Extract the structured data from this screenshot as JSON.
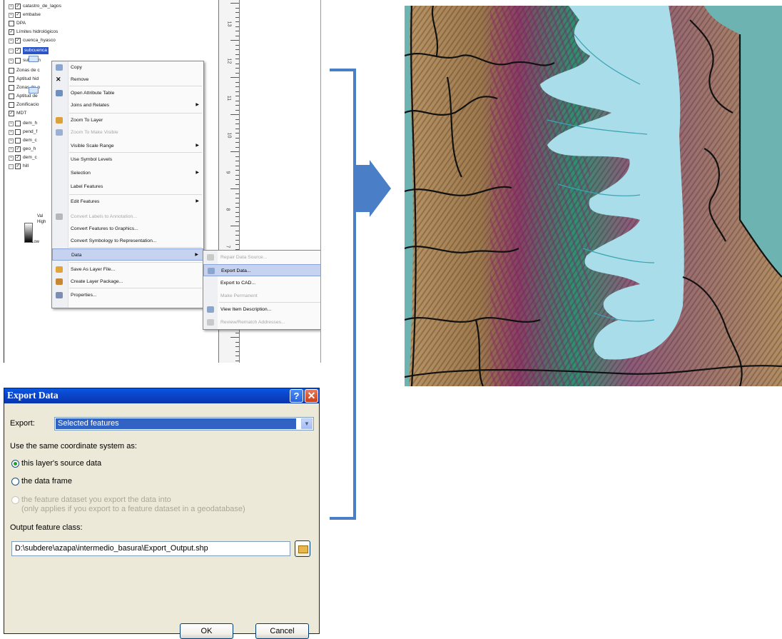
{
  "toc": {
    "items": [
      {
        "label": "catastro_de_lagos",
        "checked": true,
        "expand": "+"
      },
      {
        "label": "embalse",
        "checked": true,
        "expand": "+"
      },
      {
        "label": "DPA",
        "checked": false,
        "expand": ""
      },
      {
        "label": "Límites hidrológicos",
        "checked": true,
        "expand": ""
      },
      {
        "label": "cuenca_hyasco",
        "checked": true,
        "expand": "+"
      },
      {
        "label": "subcuenca",
        "checked": true,
        "expand": "-",
        "selected": true
      },
      {
        "label": "subcuen",
        "checked": false,
        "expand": "+"
      },
      {
        "label": "Zonas de c",
        "checked": false,
        "expand": ""
      },
      {
        "label": "Aptitud hid",
        "checked": false,
        "expand": ""
      },
      {
        "label": "Zonas de p",
        "checked": false,
        "expand": ""
      },
      {
        "label": "Aptitud de",
        "checked": false,
        "expand": ""
      },
      {
        "label": "Zonificacio",
        "checked": false,
        "expand": ""
      },
      {
        "label": "MDT",
        "checked": true,
        "expand": ""
      },
      {
        "label": "dem_h",
        "checked": false,
        "expand": "+"
      },
      {
        "label": "pend_f",
        "checked": false,
        "expand": "+"
      },
      {
        "label": "dem_c",
        "checked": false,
        "expand": "+"
      },
      {
        "label": "geo_h",
        "checked": true,
        "expand": "+"
      },
      {
        "label": "dem_c",
        "checked": true,
        "expand": "+"
      },
      {
        "label": "hill",
        "checked": true,
        "expand": "-"
      }
    ],
    "ramp_high": "High",
    "ramp_low": "Low",
    "ramp_value": "Val"
  },
  "ruler": {
    "numbers": [
      "13",
      "12",
      "11",
      "10",
      "9",
      "8",
      "7",
      "6",
      "5"
    ]
  },
  "context_menu": {
    "items": [
      {
        "label": "Copy",
        "icon": "copy-icon",
        "disabled": false,
        "submenu": false
      },
      {
        "label": "Remove",
        "icon": "remove-icon",
        "disabled": false,
        "submenu": false
      },
      {
        "label": "Open Attribute Table",
        "icon": "table-icon",
        "disabled": false,
        "submenu": false
      },
      {
        "label": "Joins and Relates",
        "icon": "",
        "disabled": false,
        "submenu": true
      },
      {
        "label": "Zoom To Layer",
        "icon": "zoom-layer-icon",
        "disabled": false,
        "submenu": false
      },
      {
        "label": "Zoom To Make Visible",
        "icon": "zoom-visible-icon",
        "disabled": true,
        "submenu": false
      },
      {
        "label": "Visible Scale Range",
        "icon": "",
        "disabled": false,
        "submenu": true
      },
      {
        "label": "Use Symbol Levels",
        "icon": "",
        "disabled": false,
        "submenu": false
      },
      {
        "label": "Selection",
        "icon": "",
        "disabled": false,
        "submenu": true
      },
      {
        "label": "Label Features",
        "icon": "",
        "disabled": false,
        "submenu": false
      },
      {
        "label": "Edit Features",
        "icon": "",
        "disabled": false,
        "submenu": true
      },
      {
        "label": "Convert Labels to Annotation...",
        "icon": "annotation-icon",
        "disabled": true,
        "submenu": false
      },
      {
        "label": "Convert Features to Graphics...",
        "icon": "",
        "disabled": false,
        "submenu": false
      },
      {
        "label": "Convert Symbology to Representation...",
        "icon": "",
        "disabled": false,
        "submenu": false
      },
      {
        "label": "Data",
        "icon": "",
        "disabled": false,
        "submenu": true,
        "highlighted": true
      },
      {
        "label": "Save As Layer File...",
        "icon": "save-layer-icon",
        "disabled": false,
        "submenu": false
      },
      {
        "label": "Create Layer Package...",
        "icon": "package-icon",
        "disabled": false,
        "submenu": false
      },
      {
        "label": "Properties...",
        "icon": "properties-icon",
        "disabled": false,
        "submenu": false
      }
    ]
  },
  "data_submenu": {
    "items": [
      {
        "label": "Repair Data Source...",
        "disabled": true
      },
      {
        "label": "Export Data...",
        "disabled": false,
        "highlighted": true
      },
      {
        "label": "Export to CAD...",
        "disabled": false
      },
      {
        "label": "Make Permanent",
        "disabled": true
      },
      {
        "label": "View Item Description...",
        "disabled": false
      },
      {
        "label": "Review/Rematch Addresses...",
        "disabled": true
      }
    ]
  },
  "dialog": {
    "title": "Export Data",
    "help_glyph": "?",
    "close_glyph": "✕",
    "export_label": "Export:",
    "export_value": "Selected features",
    "coord_label": "Use the same coordinate system as:",
    "option_source": "this layer's source data",
    "option_frame": "the data frame",
    "option_dataset_line1": "the feature dataset you export the data into",
    "option_dataset_line2": "(only applies if you export to a feature dataset in a geodatabase)",
    "selected_option": "source",
    "output_label": "Output feature class:",
    "output_path": "D:\\subdere\\azapa\\intermedio_basura\\Export_Output.shp",
    "ok_label": "OK",
    "cancel_label": "Cancel"
  },
  "colors": {
    "arrow": "#4a7fc7",
    "dialog_title": "#0a47c9",
    "lake": "#a9dde9",
    "sea": "#6fb3b1",
    "forest": "#1e8f6f",
    "magenta": "#8e2c6b",
    "terrain": "#b08a5a"
  }
}
